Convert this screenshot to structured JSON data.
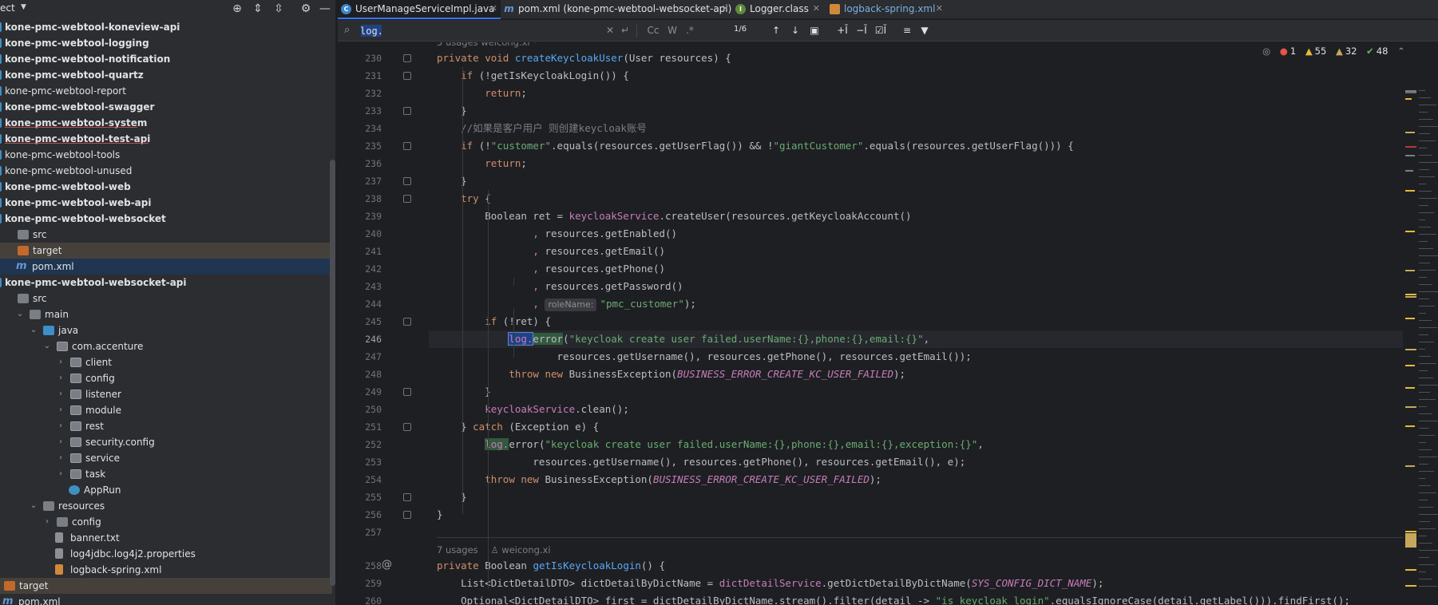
{
  "project_panel": {
    "title": "ect",
    "items": [
      {
        "label": "kone-pmc-webtool-koneview-api",
        "bold": true,
        "indent": 0,
        "icon": "module",
        "arrow": ""
      },
      {
        "label": "kone-pmc-webtool-logging",
        "bold": true,
        "indent": 0,
        "icon": "module",
        "arrow": ""
      },
      {
        "label": "kone-pmc-webtool-notification",
        "bold": true,
        "indent": 0,
        "icon": "module",
        "arrow": ""
      },
      {
        "label": "kone-pmc-webtool-quartz",
        "bold": true,
        "indent": 0,
        "icon": "module",
        "arrow": ""
      },
      {
        "label": "kone-pmc-webtool-report",
        "bold": false,
        "indent": 0,
        "icon": "module",
        "arrow": ""
      },
      {
        "label": "kone-pmc-webtool-swagger",
        "bold": true,
        "indent": 0,
        "icon": "module",
        "arrow": ""
      },
      {
        "label": "kone-pmc-webtool-system",
        "bold": true,
        "indent": 0,
        "icon": "module",
        "arrow": "",
        "error": true
      },
      {
        "label": "kone-pmc-webtool-test-api",
        "bold": true,
        "indent": 0,
        "icon": "module",
        "arrow": "",
        "error": true
      },
      {
        "label": "kone-pmc-webtool-tools",
        "bold": false,
        "indent": 0,
        "icon": "module",
        "arrow": ""
      },
      {
        "label": "kone-pmc-webtool-unused",
        "bold": false,
        "indent": 0,
        "icon": "module",
        "arrow": ""
      },
      {
        "label": "kone-pmc-webtool-web",
        "bold": true,
        "indent": 0,
        "icon": "module",
        "arrow": ""
      },
      {
        "label": "kone-pmc-webtool-web-api",
        "bold": true,
        "indent": 0,
        "icon": "module",
        "arrow": ""
      },
      {
        "label": "kone-pmc-webtool-websocket",
        "bold": true,
        "indent": 0,
        "icon": "module",
        "arrow": ""
      },
      {
        "label": "src",
        "bold": false,
        "indent": 1,
        "icon": "folder-gray",
        "arrow": ""
      },
      {
        "label": "target",
        "bold": false,
        "indent": 1,
        "icon": "folder-orange",
        "arrow": "",
        "row": "target"
      },
      {
        "label": "pom.xml",
        "bold": false,
        "indent": 1,
        "icon": "maven",
        "arrow": "",
        "row": "selected"
      },
      {
        "label": "kone-pmc-webtool-websocket-api",
        "bold": true,
        "indent": 0,
        "icon": "module",
        "arrow": ""
      },
      {
        "label": "src",
        "bold": false,
        "indent": 1,
        "icon": "folder-gray",
        "arrow": ""
      },
      {
        "label": "main",
        "bold": false,
        "indent": 1,
        "icon": "folder-gray",
        "arrow": "expanded"
      },
      {
        "label": "java",
        "bold": false,
        "indent": 2,
        "icon": "folder-blue",
        "arrow": "expanded"
      },
      {
        "label": "com.accenture",
        "bold": false,
        "indent": 3,
        "icon": "package",
        "arrow": "expanded"
      },
      {
        "label": "client",
        "bold": false,
        "indent": 4,
        "icon": "package",
        "arrow": "collapsed"
      },
      {
        "label": "config",
        "bold": false,
        "indent": 4,
        "icon": "package",
        "arrow": "collapsed"
      },
      {
        "label": "listener",
        "bold": false,
        "indent": 4,
        "icon": "package",
        "arrow": "collapsed"
      },
      {
        "label": "module",
        "bold": false,
        "indent": 4,
        "icon": "package",
        "arrow": "collapsed"
      },
      {
        "label": "rest",
        "bold": false,
        "indent": 4,
        "icon": "package",
        "arrow": "collapsed"
      },
      {
        "label": "security.config",
        "bold": false,
        "indent": 4,
        "icon": "package",
        "arrow": "collapsed"
      },
      {
        "label": "service",
        "bold": false,
        "indent": 4,
        "icon": "package",
        "arrow": "collapsed"
      },
      {
        "label": "task",
        "bold": false,
        "indent": 4,
        "icon": "package",
        "arrow": "collapsed"
      },
      {
        "label": "AppRun",
        "bold": false,
        "indent": 4,
        "icon": "app",
        "arrow": ""
      },
      {
        "label": "resources",
        "bold": false,
        "indent": 2,
        "icon": "folder-gray",
        "arrow": "expanded"
      },
      {
        "label": "config",
        "bold": false,
        "indent": 3,
        "icon": "folder-gray",
        "arrow": "collapsed"
      },
      {
        "label": "banner.txt",
        "bold": false,
        "indent": 3,
        "icon": "txt",
        "arrow": ""
      },
      {
        "label": "log4jdbc.log4j2.properties",
        "bold": false,
        "indent": 3,
        "icon": "props",
        "arrow": ""
      },
      {
        "label": "logback-spring.xml",
        "bold": false,
        "indent": 3,
        "icon": "xml",
        "arrow": ""
      },
      {
        "label": "target",
        "bold": false,
        "indent": 0,
        "icon": "folder-orange",
        "arrow": "",
        "row": "target"
      },
      {
        "label": "pom.xml",
        "bold": false,
        "indent": 0,
        "icon": "maven",
        "arrow": ""
      }
    ]
  },
  "tabs": [
    {
      "label": "UserManageServiceImpl.java",
      "icon": "class",
      "glyph": "C",
      "active": true
    },
    {
      "label": "pom.xml (kone-pmc-webtool-websocket-api)",
      "icon": "maven",
      "glyph": "m",
      "active": false
    },
    {
      "label": "Logger.class",
      "icon": "logger",
      "glyph": "I",
      "active": false
    },
    {
      "label": "logback-spring.xml",
      "icon": "xml",
      "glyph": "",
      "active": false
    }
  ],
  "find_bar": {
    "query": "log.",
    "match_count": "1/6",
    "options": [
      "Cc",
      "W",
      ".*"
    ]
  },
  "inspections": {
    "errors": "1",
    "warnings": "55",
    "weak": "32",
    "ok": "48"
  },
  "editor": {
    "top_meta": "3 usages   weicong.xi  *",
    "method_meta": [
      "7 usages",
      "weicong.xi"
    ],
    "current_line": 246,
    "lines": [
      {
        "n": 230,
        "html": "<span class=\"kw\">private void </span><span class=\"fn\">createKeycloakUser</span>(User resources) {"
      },
      {
        "n": 231,
        "html": "    <span class=\"kw\">if </span>(!getIsKeycloakLogin()) {"
      },
      {
        "n": 232,
        "html": "        <span class=\"kw\">return</span>;"
      },
      {
        "n": 233,
        "html": "    }"
      },
      {
        "n": 234,
        "html": "    <span class=\"cm\">//如果是客户用户 则创建keycloak账号</span>"
      },
      {
        "n": 235,
        "html": "    <span class=\"kw\">if </span>(!<span class=\"str\">\"customer\"</span>.equals(resources.getUserFlag()) &amp;&amp; !<span class=\"str\">\"giantCustomer\"</span>.equals(resources.getUserFlag())) {"
      },
      {
        "n": 236,
        "html": "        <span class=\"kw\">return</span>;"
      },
      {
        "n": 237,
        "html": "    }"
      },
      {
        "n": 238,
        "html": "    <span class=\"kw\">try </span>{"
      },
      {
        "n": 239,
        "html": "        Boolean ret = <span class=\"fld\">keycloakService</span>.createUser(resources.getKeycloakAccount()"
      },
      {
        "n": 240,
        "html": "                <span class=\"kw\">, </span>resources.getEnabled()"
      },
      {
        "n": 241,
        "html": "                <span class=\"kw\">, </span>resources.getEmail()"
      },
      {
        "n": 242,
        "html": "                <span class=\"kw\">, </span>resources.getPhone()"
      },
      {
        "n": 243,
        "html": "                <span class=\"kw\">, </span>resources.getPassword()"
      },
      {
        "n": 244,
        "html": "                <span class=\"kw\">, </span><span class=\"hint\">roleName:</span><span class=\"str\">\"pmc_customer\"</span>);"
      },
      {
        "n": 245,
        "html": "        <span class=\"kw\">if </span>(!ret) {"
      },
      {
        "n": 246,
        "html": "            <span class=\"fld match-cur\">log.</span><span class=\"match\">error</span>(<span class=\"str\">\"keycloak create user failed.userName:{},phone:{},email:{}\"</span>,"
      },
      {
        "n": 247,
        "html": "                    resources.getUsername(), resources.getPhone(), resources.getEmail());"
      },
      {
        "n": 248,
        "html": "            <span class=\"kw\">throw new </span>BusinessException(<span class=\"cst\">BUSINESS_ERROR_CREATE_KC_USER_FAILED</span>);"
      },
      {
        "n": 249,
        "html": "        }"
      },
      {
        "n": 250,
        "html": "        <span class=\"fld\">keycloakService</span>.clean();"
      },
      {
        "n": 251,
        "html": "    } <span class=\"kw\">catch </span>(Exception e) {"
      },
      {
        "n": 252,
        "html": "        <span class=\"fld match\">log.</span>error(<span class=\"str\">\"keycloak create user failed.userName:{},phone:{},email:{},exception:{}\"</span>,"
      },
      {
        "n": 253,
        "html": "                resources.getUsername(), resources.getPhone(), resources.getEmail(), e);"
      },
      {
        "n": 254,
        "html": "        <span class=\"kw\">throw new </span>BusinessException(<span class=\"cst\">BUSINESS_ERROR_CREATE_KC_USER_FAILED</span>);"
      },
      {
        "n": 255,
        "html": "    }"
      },
      {
        "n": 256,
        "html": "}"
      },
      {
        "n": 257,
        "html": ""
      },
      {
        "n": 258,
        "html": "<span class=\"kw\">private </span>Boolean <span class=\"fn\">getIsKeycloakLogin</span>() {"
      },
      {
        "n": 259,
        "html": "    List&lt;DictDetailDTO&gt; dictDetailByDictName = <span class=\"fld\">dictDetailService</span>.getDictDetailByDictName(<span class=\"cst\">SYS_CONFIG_DICT_NAME</span>);"
      },
      {
        "n": 260,
        "html": "    Optional&lt;DictDetailDTO&gt; first = dictDetailByDictName.stream().filter(detail -&gt; <span class=\"str\">\"is_keycloak_login\"</span>.equalsIgnoreCase(detail.getLabel())).findFirst();"
      }
    ]
  },
  "colors": {
    "accent": "#3574f0",
    "selection": "#1f3550",
    "match_current": "#214283",
    "match": "#32593d"
  }
}
